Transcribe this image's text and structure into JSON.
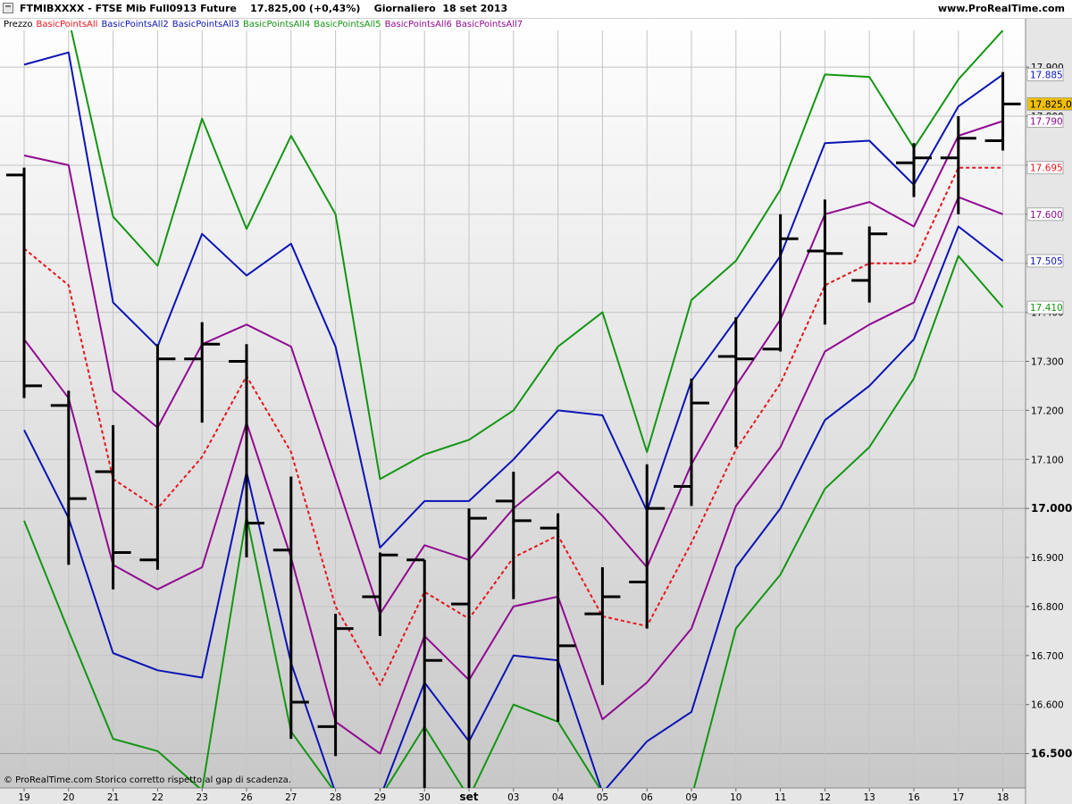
{
  "window": {
    "title": "FTMIBXXXX - FTSE Mib Full0913 Future    17.825,00 (+0,43%)    Giornaliero  18 set 2013",
    "brand": "www.ProRealTime.com"
  },
  "legend": [
    {
      "text": "Prezzo",
      "color": "#000000"
    },
    {
      "text": "BasicPointsAll",
      "color": "#e8141c"
    },
    {
      "text": "BasicPointsAll2",
      "color": "#0a14b4"
    },
    {
      "text": "BasicPointsAll3",
      "color": "#0a14b4"
    },
    {
      "text": "BasicPointsAll4",
      "color": "#129612"
    },
    {
      "text": "BasicPointsAll5",
      "color": "#129612"
    },
    {
      "text": "BasicPointsAll6",
      "color": "#910a91"
    },
    {
      "text": "BasicPointsAll7",
      "color": "#910a91"
    }
  ],
  "footer": "© ProRealTime.com Storico corretto rispetto al gap di scadenza.",
  "chart_data": {
    "type": "line",
    "title": "FTSE Mib Full0913 Future",
    "background_gradient": true,
    "grid": true,
    "y_axis_side": "right",
    "ylim": [
      16430,
      17975
    ],
    "y_ticks": [
      {
        "value": 16500,
        "label": "16.500"
      },
      {
        "value": 16600,
        "label": "16.600"
      },
      {
        "value": 16700,
        "label": "16.700"
      },
      {
        "value": 16800,
        "label": "16.800"
      },
      {
        "value": 16900,
        "label": "16.900"
      },
      {
        "value": 17000,
        "label": "17.000"
      },
      {
        "value": 17100,
        "label": "17.100"
      },
      {
        "value": 17200,
        "label": "17.200"
      },
      {
        "value": 17300,
        "label": "17.300"
      },
      {
        "value": 17400,
        "label": "17.400"
      },
      {
        "value": 17500,
        "label": "17.500"
      },
      {
        "value": 17600,
        "label": "17.600"
      },
      {
        "value": 17700,
        "label": "17.700"
      },
      {
        "value": 17800,
        "label": "17.800"
      },
      {
        "value": 17900,
        "label": "17.900"
      }
    ],
    "bold_y_ticks": [
      16500,
      17000
    ],
    "categories": [
      "19",
      "20",
      "21",
      "22",
      "23",
      "26",
      "27",
      "28",
      "29",
      "30",
      "set",
      "03",
      "04",
      "05",
      "06",
      "09",
      "10",
      "11",
      "12",
      "13",
      "16",
      "17",
      "18"
    ],
    "bold_categories": [
      "set"
    ],
    "right_labels": [
      {
        "value": 17885,
        "label": "17.885",
        "color": "#0a14b4",
        "bg": "#ffffff"
      },
      {
        "value": 17825,
        "label": "17.825,00",
        "color": "#000000",
        "bg": "#f0c000"
      },
      {
        "value": 17790,
        "label": "17.790",
        "color": "#910a91",
        "bg": "#ffffff"
      },
      {
        "value": 17695,
        "label": "17.695",
        "color": "#e8141c",
        "bg": "#ffffff"
      },
      {
        "value": 17600,
        "label": "17.600",
        "color": "#910a91",
        "bg": "#ffffff"
      },
      {
        "value": 17505,
        "label": "17.505",
        "color": "#0a14b4",
        "bg": "#ffffff"
      },
      {
        "value": 17410,
        "label": "17.410",
        "color": "#129612",
        "bg": "#ffffff"
      }
    ],
    "ohlc": [
      {
        "x": "19",
        "open": 17680,
        "high": 17695,
        "low": 17225,
        "close": 17250
      },
      {
        "x": "20",
        "open": 17210,
        "high": 17240,
        "low": 16885,
        "close": 17020
      },
      {
        "x": "21",
        "open": 17075,
        "high": 17170,
        "low": 16835,
        "close": 16910
      },
      {
        "x": "22",
        "open": 16895,
        "high": 17335,
        "low": 16875,
        "close": 17305
      },
      {
        "x": "23",
        "open": 17305,
        "high": 17380,
        "low": 17175,
        "close": 17335
      },
      {
        "x": "26",
        "open": 17300,
        "high": 17335,
        "low": 16900,
        "close": 16970
      },
      {
        "x": "27",
        "open": 16915,
        "high": 17065,
        "low": 16530,
        "close": 16605
      },
      {
        "x": "28",
        "open": 16555,
        "high": 16785,
        "low": 16495,
        "close": 16755
      },
      {
        "x": "29",
        "open": 16820,
        "high": 16910,
        "low": 16740,
        "close": 16905
      },
      {
        "x": "30",
        "open": 16895,
        "high": 16895,
        "low": 16430,
        "close": 16690
      },
      {
        "x": "set",
        "open": 16805,
        "high": 17000,
        "low": 16430,
        "close": 16980
      },
      {
        "x": "03",
        "open": 17015,
        "high": 17075,
        "low": 16815,
        "close": 16975
      },
      {
        "x": "04",
        "open": 16960,
        "high": 16990,
        "low": 16565,
        "close": 16720
      },
      {
        "x": "05",
        "open": 16785,
        "high": 16880,
        "low": 16640,
        "close": 16820
      },
      {
        "x": "06",
        "open": 16850,
        "high": 17090,
        "low": 16755,
        "close": 17000
      },
      {
        "x": "09",
        "open": 17045,
        "high": 17265,
        "low": 17005,
        "close": 17215
      },
      {
        "x": "10",
        "open": 17310,
        "high": 17390,
        "low": 17125,
        "close": 17305
      },
      {
        "x": "11",
        "open": 17325,
        "high": 17600,
        "low": 17320,
        "close": 17550
      },
      {
        "x": "12",
        "open": 17525,
        "high": 17630,
        "low": 17375,
        "close": 17520
      },
      {
        "x": "13",
        "open": 17465,
        "high": 17575,
        "low": 17420,
        "close": 17560
      },
      {
        "x": "16",
        "open": 17705,
        "high": 17745,
        "low": 17635,
        "close": 17715
      },
      {
        "x": "17",
        "open": 17715,
        "high": 17800,
        "low": 17600,
        "close": 17755
      },
      {
        "x": "18",
        "open": 17750,
        "high": 17890,
        "low": 17730,
        "close": 17825
      }
    ],
    "series": [
      {
        "name": "BasicPointsAll",
        "color": "#e8141c",
        "dashed": true,
        "values": [
          17530,
          17455,
          17060,
          17000,
          17105,
          17270,
          17115,
          16800,
          16640,
          16830,
          16775,
          16900,
          16945,
          16780,
          16760,
          16930,
          17120,
          17255,
          17455,
          17500,
          17500,
          17695,
          17695
        ]
      },
      {
        "name": "BasicPointsAll2",
        "color": "#0a14b4",
        "dashed": false,
        "values": [
          17905,
          17930,
          17420,
          17330,
          17560,
          17475,
          17540,
          17330,
          16920,
          17015,
          17015,
          17100,
          17200,
          17190,
          16995,
          17260,
          17385,
          17515,
          17745,
          17750,
          17660,
          17820,
          17885
        ]
      },
      {
        "name": "BasicPointsAll3",
        "color": "#0a14b4",
        "dashed": false,
        "values": [
          17160,
          16980,
          16705,
          16670,
          16655,
          17075,
          16685,
          16420,
          16410,
          16645,
          16525,
          16700,
          16690,
          16420,
          16525,
          16585,
          16880,
          17000,
          17180,
          17250,
          17345,
          17575,
          17505
        ]
      },
      {
        "name": "BasicPointsAll4",
        "color": "#129612",
        "dashed": false,
        "values": [
          18000,
          18000,
          17595,
          17495,
          17795,
          17570,
          17760,
          17600,
          17060,
          17110,
          17140,
          17200,
          17330,
          17400,
          17115,
          17425,
          17505,
          17650,
          17885,
          17880,
          17735,
          17875,
          17975
        ]
      },
      {
        "name": "BasicPointsAll5",
        "color": "#129612",
        "dashed": false,
        "values": [
          16975,
          16750,
          16530,
          16505,
          16425,
          16985,
          16545,
          16420,
          16410,
          16555,
          16410,
          16600,
          16565,
          16420,
          16420,
          16410,
          16755,
          16865,
          17040,
          17125,
          17265,
          17515,
          17410
        ]
      },
      {
        "name": "BasicPointsAll6",
        "color": "#910a91",
        "dashed": false,
        "values": [
          17720,
          17700,
          17240,
          17165,
          17335,
          17375,
          17330,
          17060,
          16785,
          16925,
          16895,
          17000,
          17075,
          16985,
          16880,
          17090,
          17250,
          17385,
          17600,
          17625,
          17575,
          17760,
          17790
        ]
      },
      {
        "name": "BasicPointsAll7",
        "color": "#910a91",
        "dashed": false,
        "values": [
          17345,
          17225,
          16885,
          16835,
          16880,
          17175,
          16900,
          16565,
          16500,
          16740,
          16650,
          16800,
          16820,
          16570,
          16645,
          16755,
          17005,
          17125,
          17320,
          17375,
          17420,
          17635,
          17600
        ]
      }
    ]
  }
}
